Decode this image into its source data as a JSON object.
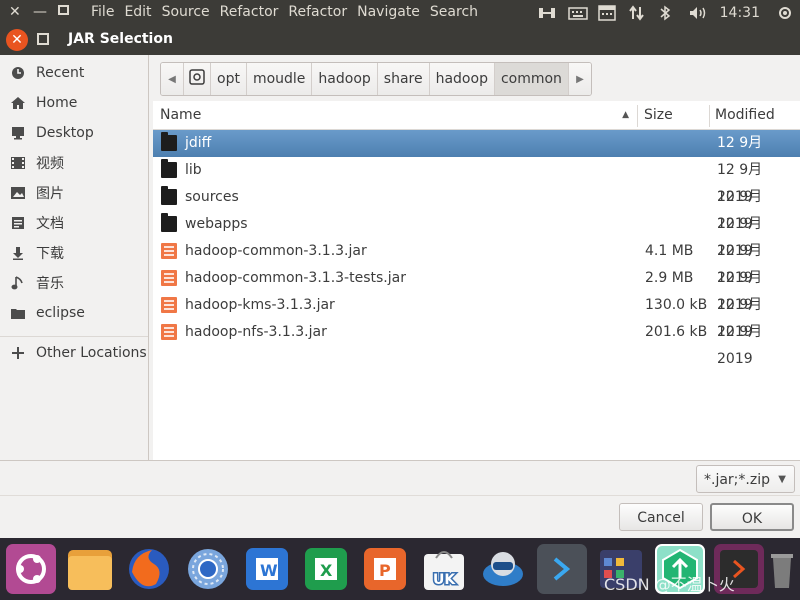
{
  "topbar": {
    "menus": [
      "File",
      "Edit",
      "Source",
      "Refactor",
      "Refactor",
      "Navigate",
      "Search"
    ],
    "time": "14:31"
  },
  "window": {
    "title": "JAR Selection"
  },
  "sidebar": {
    "items": [
      {
        "label": "Recent",
        "icon": "clock-icon"
      },
      {
        "label": "Home",
        "icon": "home-icon"
      },
      {
        "label": "Desktop",
        "icon": "desktop-icon"
      },
      {
        "label": "视频",
        "icon": "video-icon"
      },
      {
        "label": "图片",
        "icon": "picture-icon"
      },
      {
        "label": "文档",
        "icon": "document-icon"
      },
      {
        "label": "下载",
        "icon": "download-icon"
      },
      {
        "label": "音乐",
        "icon": "music-icon"
      },
      {
        "label": "eclipse",
        "icon": "folder-icon"
      },
      {
        "label": "Other Locations",
        "icon": "plus-icon"
      }
    ]
  },
  "pathbar": {
    "segments": [
      "opt",
      "moudle",
      "hadoop",
      "share",
      "hadoop",
      "common"
    ],
    "active": "common"
  },
  "filelist": {
    "headers": {
      "name": "Name",
      "size": "Size",
      "modified": "Modified"
    },
    "rows": [
      {
        "name": "jdiff",
        "type": "folder",
        "size": "",
        "modified": "12 9月 2019",
        "selected": true
      },
      {
        "name": "lib",
        "type": "folder",
        "size": "",
        "modified": "12 9月 2019"
      },
      {
        "name": "sources",
        "type": "folder",
        "size": "",
        "modified": "12 9月 2019"
      },
      {
        "name": "webapps",
        "type": "folder",
        "size": "",
        "modified": "12 9月 2019"
      },
      {
        "name": "hadoop-common-3.1.3.jar",
        "type": "jar",
        "size": "4.1 MB",
        "modified": "12 9月 2019"
      },
      {
        "name": "hadoop-common-3.1.3-tests.jar",
        "type": "jar",
        "size": "2.9 MB",
        "modified": "12 9月 2019"
      },
      {
        "name": "hadoop-kms-3.1.3.jar",
        "type": "jar",
        "size": "130.0 kB",
        "modified": "12 9月 2019"
      },
      {
        "name": "hadoop-nfs-3.1.3.jar",
        "type": "jar",
        "size": "201.6 kB",
        "modified": "12 9月 2019"
      }
    ]
  },
  "filter": {
    "value": "*.jar;*.zip"
  },
  "buttons": {
    "cancel": "Cancel",
    "ok": "OK"
  },
  "launcher": {
    "apps": [
      "ubuntu-dash",
      "files",
      "firefox",
      "chromium",
      "wps-writer",
      "wps-spreadsheet",
      "wps-presentation",
      "ubuntu-software",
      "remote-viewer",
      "terminal-app",
      "workspace-switcher",
      "software-updater",
      "terminal",
      "trash"
    ]
  },
  "watermark": "CSDN @不温卜火"
}
